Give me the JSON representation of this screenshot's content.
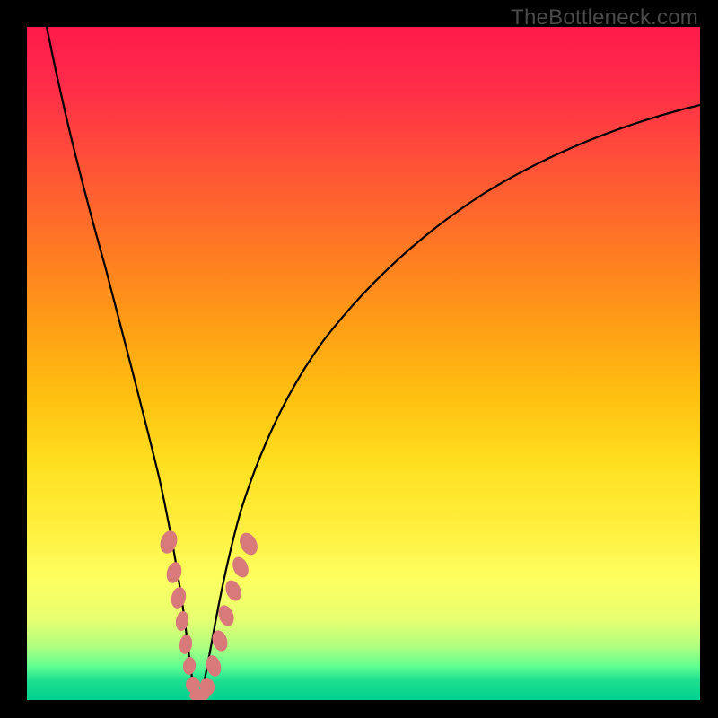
{
  "watermark": "TheBottleneck.com",
  "chart_data": {
    "type": "line",
    "title": "",
    "xlabel": "",
    "ylabel": "",
    "xlim": [
      0,
      100
    ],
    "ylim": [
      0,
      100
    ],
    "grid": false,
    "legend": false,
    "series": [
      {
        "name": "bottleneck-curve",
        "x": [
          3,
          5,
          8,
          11,
          14,
          17,
          19,
          21,
          22.5,
          23.5,
          24.5,
          25.5,
          27,
          29,
          31,
          34,
          38,
          43,
          50,
          58,
          67,
          76,
          85,
          94,
          100
        ],
        "y": [
          100,
          90,
          78,
          65,
          52,
          38,
          27,
          17,
          9,
          3,
          0,
          2,
          8,
          18,
          27,
          37,
          47,
          56,
          64,
          71,
          76,
          80,
          83,
          85,
          86
        ]
      }
    ],
    "markers": {
      "name": "highlight-points",
      "color": "#d87a7a",
      "x": [
        20.5,
        21.5,
        22.2,
        22.8,
        23.5,
        24.2,
        25.0,
        25.8,
        26.8,
        27.8,
        28.6,
        29.5,
        30.3,
        31.0,
        31.8
      ],
      "y": [
        22,
        16,
        11,
        7,
        3,
        1,
        1,
        3,
        8,
        13,
        18,
        22,
        26,
        29,
        32
      ]
    },
    "background_gradient": {
      "top": "#ff1a4a",
      "middle": "#ffd020",
      "bottom": "#00d090"
    }
  }
}
